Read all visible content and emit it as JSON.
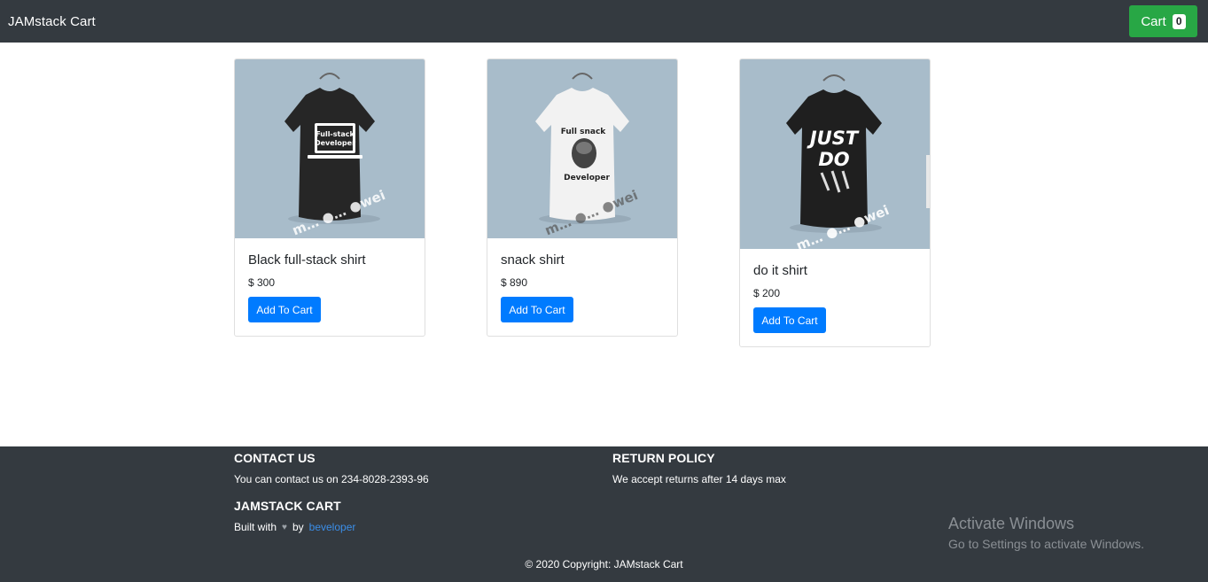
{
  "navbar": {
    "brand": "JAMstack Cart",
    "cart_label": "Cart",
    "cart_count": "0"
  },
  "products": [
    {
      "name": "Black full-stack shirt",
      "price": "$ 300",
      "button": "Add To Cart",
      "print_line1": "Full-stack",
      "print_line2": "Developer",
      "watermark": "m… ●… ●wei"
    },
    {
      "name": "snack shirt",
      "price": "$ 890",
      "button": "Add To Cart",
      "print_line1": "Full snack",
      "print_line2": "Developer",
      "watermark": "m… ●… ●wei"
    },
    {
      "name": "do it shirt",
      "price": "$ 200",
      "button": "Add To Cart",
      "print_line1": "JUST",
      "print_line2": "DO",
      "watermark": "m… ●… ●wei"
    }
  ],
  "footer": {
    "contact_heading": "CONTACT US",
    "contact_text": "You can contact us on 234-8028-2393-96",
    "return_heading": "RETURN POLICY",
    "return_text": "We accept returns after 14 days max",
    "brand_heading": "JAMSTACK CART",
    "built_with": "Built with",
    "by": "by",
    "author_link": "beveloper",
    "copyright": "© 2020 Copyright: JAMstack Cart"
  },
  "windows_watermark": {
    "title": "Activate Windows",
    "subtitle": "Go to Settings to activate Windows."
  },
  "colors": {
    "navbar_bg": "#343a40",
    "cart_button": "#28a745",
    "add_button": "#007bff",
    "image_bg": "#a8bcca"
  }
}
